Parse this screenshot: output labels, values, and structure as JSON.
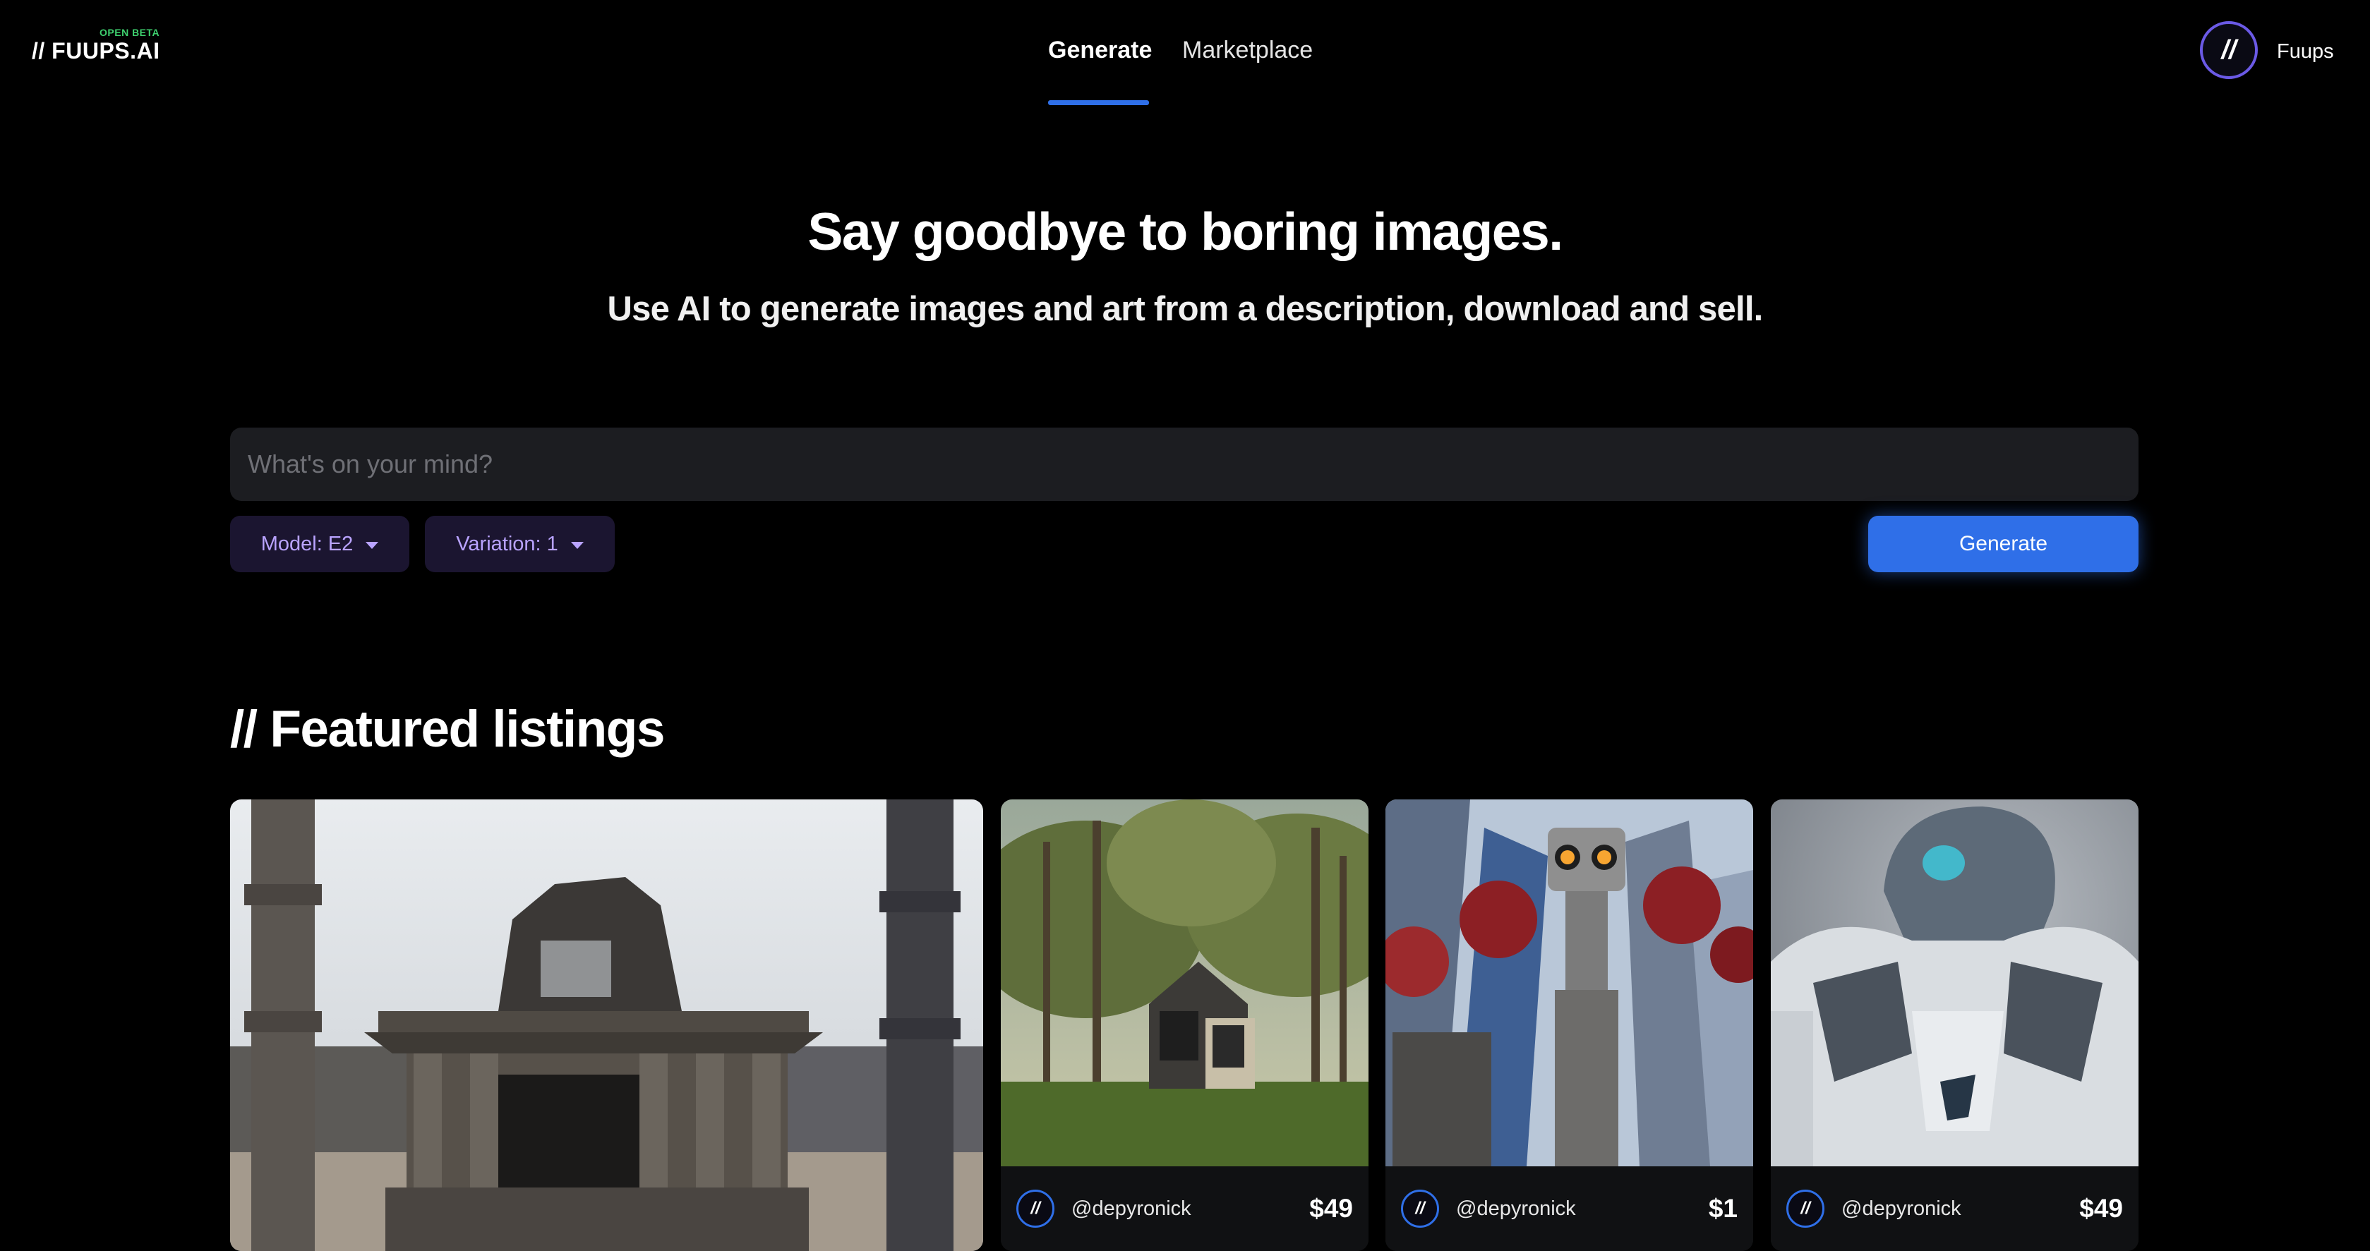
{
  "header": {
    "logo": "// FUUPS.AI",
    "badge": "OPEN BETA",
    "nav": [
      {
        "label": "Generate",
        "active": true
      },
      {
        "label": "Marketplace",
        "active": false
      }
    ],
    "avatar_glyph": "//",
    "username": "Fuups"
  },
  "hero": {
    "title": "Say goodbye to boring images.",
    "subtitle": "Use AI to generate images and art from a description, download and sell."
  },
  "prompt": {
    "placeholder": "What's on your mind?",
    "model_label": "Model: E2",
    "variation_label": "Variation: 1",
    "generate_label": "Generate"
  },
  "featured": {
    "title": "// Featured listings",
    "listings": [
      {
        "image": "ancient-temple-ruins",
        "handle": "",
        "price": ""
      },
      {
        "image": "modern-house-in-forest",
        "handle": "@depyronick",
        "price": "$49",
        "avatar_glyph": "//"
      },
      {
        "image": "giant-robot-in-city",
        "handle": "@depyronick",
        "price": "$1",
        "avatar_glyph": "//"
      },
      {
        "image": "armored-robot-figure",
        "handle": "@depyronick",
        "price": "$49",
        "avatar_glyph": "//"
      }
    ]
  },
  "colors": {
    "accent": "#2f6fe8",
    "pill_bg": "#1b1530",
    "pill_text": "#b9a3ff",
    "beta": "#3ecf6e",
    "input_bg": "#1c1d21"
  }
}
